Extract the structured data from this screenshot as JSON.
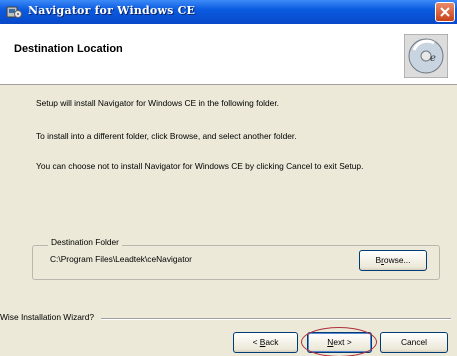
{
  "window": {
    "title": "Navigator for Windows CE",
    "icons": {
      "app": "installer-icon",
      "close": "close-icon",
      "header": "cd-disc-icon"
    }
  },
  "header": {
    "title": "Destination Location"
  },
  "body": {
    "line1": "Setup will install Navigator for Windows CE in the following folder.",
    "line2": "To install into a different folder, click Browse, and select another folder.",
    "line3": "You can choose not to install Navigator for Windows CE by clicking Cancel to exit Setup."
  },
  "destination": {
    "group_label": "Destination Folder",
    "path": "C:\\Program Files\\Leadtek\\ceNavigator",
    "browse_pre": "B",
    "browse_u": "r",
    "browse_post": "owse..."
  },
  "footer": {
    "wizard_label": "Wise Installation Wizard?",
    "back_pre": "< ",
    "back_u": "B",
    "back_post": "ack",
    "next_u": "N",
    "next_post": "ext >",
    "cancel_label": "Cancel"
  }
}
